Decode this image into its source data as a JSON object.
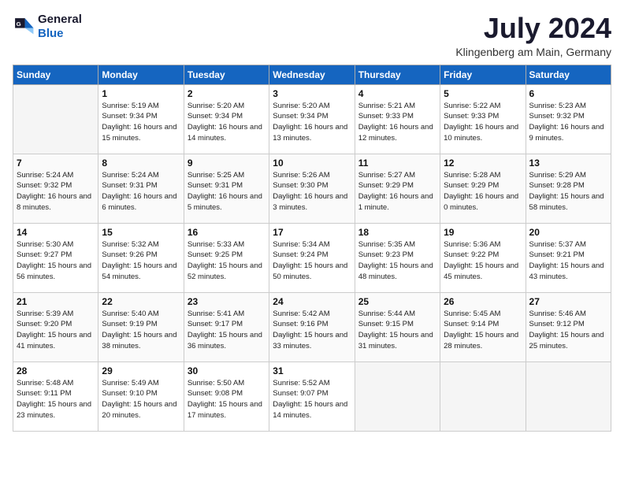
{
  "header": {
    "logo_line1": "General",
    "logo_line2": "Blue",
    "month_title": "July 2024",
    "location": "Klingenberg am Main, Germany"
  },
  "weekdays": [
    "Sunday",
    "Monday",
    "Tuesday",
    "Wednesday",
    "Thursday",
    "Friday",
    "Saturday"
  ],
  "weeks": [
    [
      {
        "day": "",
        "empty": true
      },
      {
        "day": "1",
        "sunrise": "5:19 AM",
        "sunset": "9:34 PM",
        "daylight": "16 hours and 15 minutes."
      },
      {
        "day": "2",
        "sunrise": "5:20 AM",
        "sunset": "9:34 PM",
        "daylight": "16 hours and 14 minutes."
      },
      {
        "day": "3",
        "sunrise": "5:20 AM",
        "sunset": "9:34 PM",
        "daylight": "16 hours and 13 minutes."
      },
      {
        "day": "4",
        "sunrise": "5:21 AM",
        "sunset": "9:33 PM",
        "daylight": "16 hours and 12 minutes."
      },
      {
        "day": "5",
        "sunrise": "5:22 AM",
        "sunset": "9:33 PM",
        "daylight": "16 hours and 10 minutes."
      },
      {
        "day": "6",
        "sunrise": "5:23 AM",
        "sunset": "9:32 PM",
        "daylight": "16 hours and 9 minutes."
      }
    ],
    [
      {
        "day": "7",
        "sunrise": "5:24 AM",
        "sunset": "9:32 PM",
        "daylight": "16 hours and 8 minutes."
      },
      {
        "day": "8",
        "sunrise": "5:24 AM",
        "sunset": "9:31 PM",
        "daylight": "16 hours and 6 minutes."
      },
      {
        "day": "9",
        "sunrise": "5:25 AM",
        "sunset": "9:31 PM",
        "daylight": "16 hours and 5 minutes."
      },
      {
        "day": "10",
        "sunrise": "5:26 AM",
        "sunset": "9:30 PM",
        "daylight": "16 hours and 3 minutes."
      },
      {
        "day": "11",
        "sunrise": "5:27 AM",
        "sunset": "9:29 PM",
        "daylight": "16 hours and 1 minute."
      },
      {
        "day": "12",
        "sunrise": "5:28 AM",
        "sunset": "9:29 PM",
        "daylight": "16 hours and 0 minutes."
      },
      {
        "day": "13",
        "sunrise": "5:29 AM",
        "sunset": "9:28 PM",
        "daylight": "15 hours and 58 minutes."
      }
    ],
    [
      {
        "day": "14",
        "sunrise": "5:30 AM",
        "sunset": "9:27 PM",
        "daylight": "15 hours and 56 minutes."
      },
      {
        "day": "15",
        "sunrise": "5:32 AM",
        "sunset": "9:26 PM",
        "daylight": "15 hours and 54 minutes."
      },
      {
        "day": "16",
        "sunrise": "5:33 AM",
        "sunset": "9:25 PM",
        "daylight": "15 hours and 52 minutes."
      },
      {
        "day": "17",
        "sunrise": "5:34 AM",
        "sunset": "9:24 PM",
        "daylight": "15 hours and 50 minutes."
      },
      {
        "day": "18",
        "sunrise": "5:35 AM",
        "sunset": "9:23 PM",
        "daylight": "15 hours and 48 minutes."
      },
      {
        "day": "19",
        "sunrise": "5:36 AM",
        "sunset": "9:22 PM",
        "daylight": "15 hours and 45 minutes."
      },
      {
        "day": "20",
        "sunrise": "5:37 AM",
        "sunset": "9:21 PM",
        "daylight": "15 hours and 43 minutes."
      }
    ],
    [
      {
        "day": "21",
        "sunrise": "5:39 AM",
        "sunset": "9:20 PM",
        "daylight": "15 hours and 41 minutes."
      },
      {
        "day": "22",
        "sunrise": "5:40 AM",
        "sunset": "9:19 PM",
        "daylight": "15 hours and 38 minutes."
      },
      {
        "day": "23",
        "sunrise": "5:41 AM",
        "sunset": "9:17 PM",
        "daylight": "15 hours and 36 minutes."
      },
      {
        "day": "24",
        "sunrise": "5:42 AM",
        "sunset": "9:16 PM",
        "daylight": "15 hours and 33 minutes."
      },
      {
        "day": "25",
        "sunrise": "5:44 AM",
        "sunset": "9:15 PM",
        "daylight": "15 hours and 31 minutes."
      },
      {
        "day": "26",
        "sunrise": "5:45 AM",
        "sunset": "9:14 PM",
        "daylight": "15 hours and 28 minutes."
      },
      {
        "day": "27",
        "sunrise": "5:46 AM",
        "sunset": "9:12 PM",
        "daylight": "15 hours and 25 minutes."
      }
    ],
    [
      {
        "day": "28",
        "sunrise": "5:48 AM",
        "sunset": "9:11 PM",
        "daylight": "15 hours and 23 minutes."
      },
      {
        "day": "29",
        "sunrise": "5:49 AM",
        "sunset": "9:10 PM",
        "daylight": "15 hours and 20 minutes."
      },
      {
        "day": "30",
        "sunrise": "5:50 AM",
        "sunset": "9:08 PM",
        "daylight": "15 hours and 17 minutes."
      },
      {
        "day": "31",
        "sunrise": "5:52 AM",
        "sunset": "9:07 PM",
        "daylight": "15 hours and 14 minutes."
      },
      {
        "day": "",
        "empty": true
      },
      {
        "day": "",
        "empty": true
      },
      {
        "day": "",
        "empty": true
      }
    ]
  ]
}
